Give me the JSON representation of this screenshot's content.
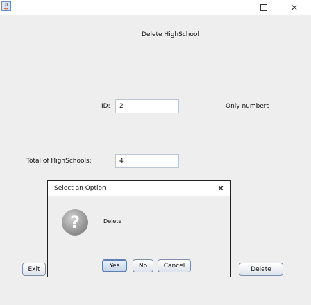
{
  "window": {
    "title_icon": "java-app-icon",
    "minimize": "—",
    "maximize": "☐",
    "close": "✕"
  },
  "form": {
    "heading": "Delete HighSchool",
    "id_label": "ID:",
    "id_value": "2",
    "id_hint": "Only numbers",
    "total_label": "Total of HighSchools:",
    "total_value": "4",
    "exit_label": "Exit",
    "delete_label": "Delete"
  },
  "dialog": {
    "title": "Select an Option",
    "close": "✕",
    "message": "Delete",
    "icon": "question-icon",
    "buttons": [
      "Yes",
      "No",
      "Cancel"
    ]
  }
}
